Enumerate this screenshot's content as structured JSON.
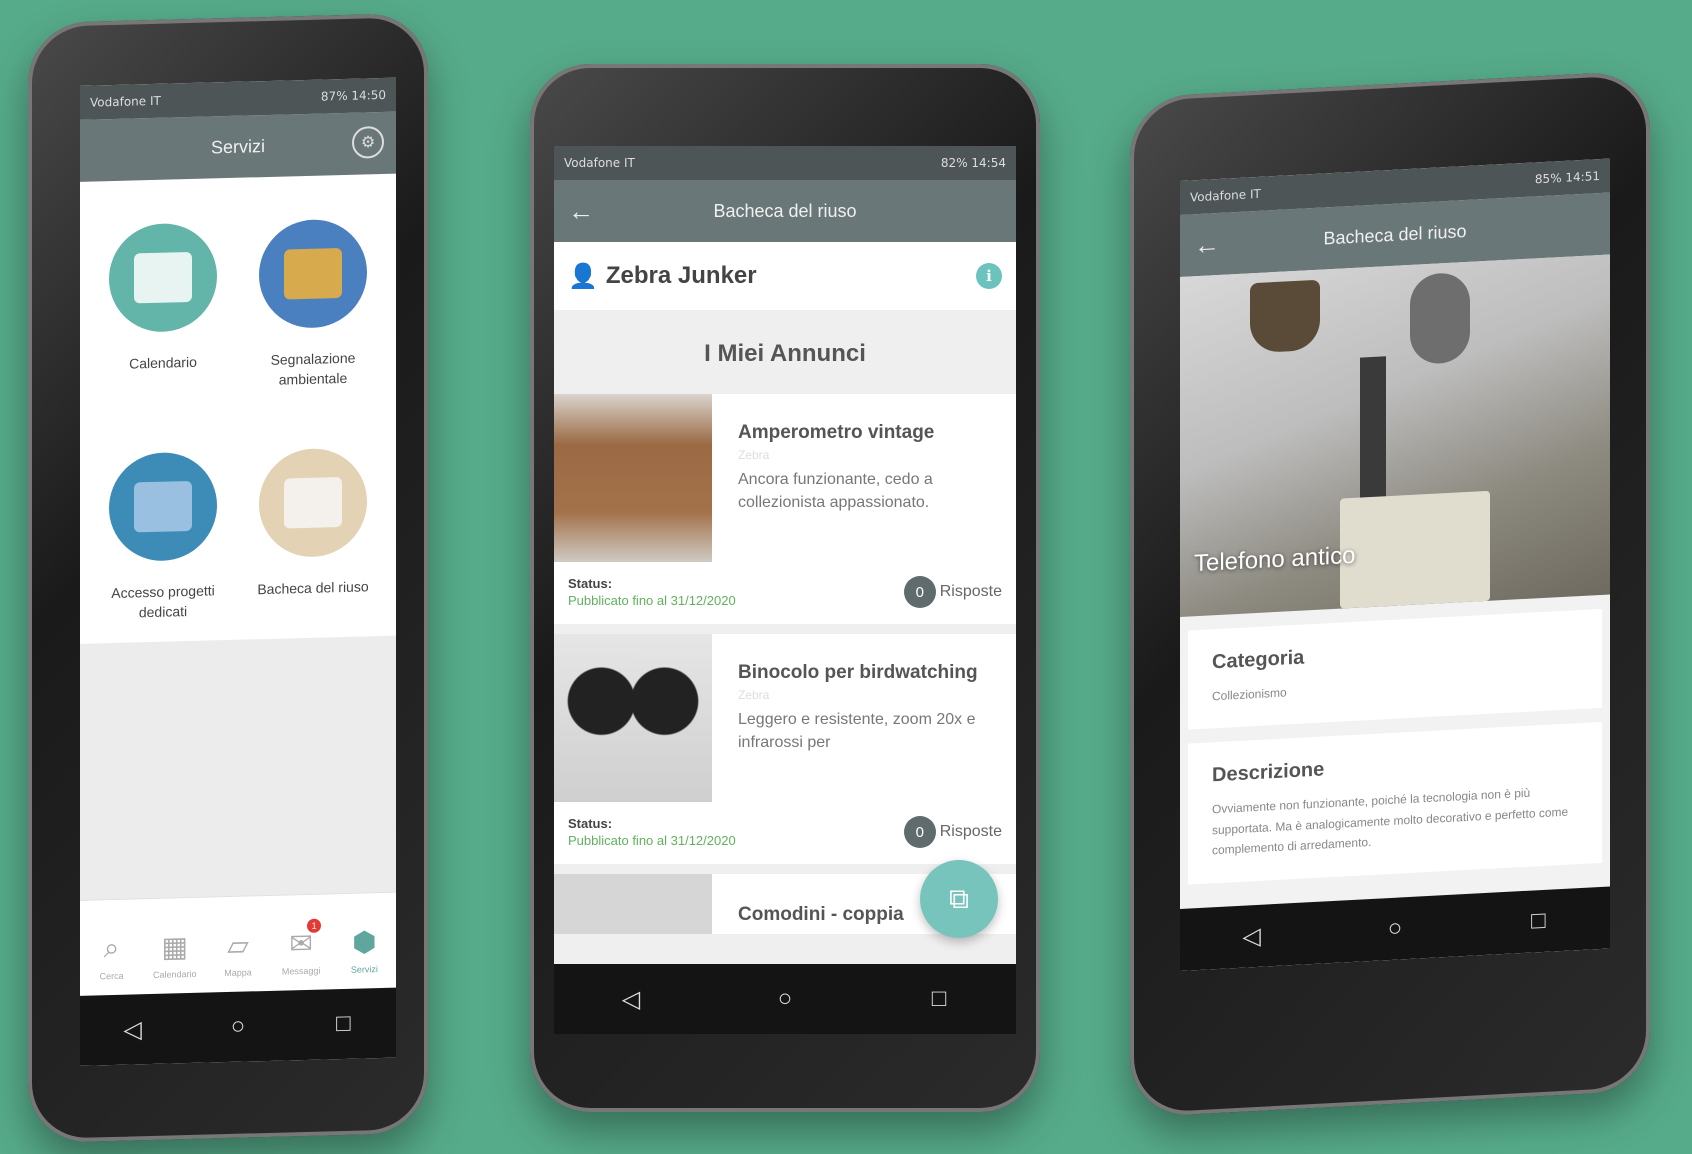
{
  "background_color": "#56ab8a",
  "phone1": {
    "status": {
      "left": "Vodafone IT",
      "right": "87% 14:50"
    },
    "appbar": {
      "title": "Servizi"
    },
    "services": [
      {
        "label": "Calendario",
        "color": "#62b5a8",
        "icon": "calendar-icon"
      },
      {
        "label": "Segnalazione ambientale",
        "color": "#4a7fc0",
        "icon": "report-icon"
      },
      {
        "label": "Accesso progetti dedicati",
        "color": "#3d8cb8",
        "icon": "id-card-icon"
      },
      {
        "label": "Bacheca del riuso",
        "color": "#e3d2b4",
        "icon": "recycle-icon"
      }
    ],
    "tabs": [
      {
        "label": "Cerca",
        "icon": "search-icon"
      },
      {
        "label": "Calendario",
        "icon": "calendar-icon"
      },
      {
        "label": "Mappa",
        "icon": "map-icon"
      },
      {
        "label": "Messaggi",
        "icon": "mail-icon",
        "badge": "1"
      },
      {
        "label": "Servizi",
        "icon": "services-icon"
      }
    ]
  },
  "phone2": {
    "status": {
      "left": "Vodafone IT",
      "right": "82% 14:54"
    },
    "appbar": {
      "title": "Bacheca del riuso"
    },
    "user": {
      "name": "Zebra Junker"
    },
    "section_title": "I Miei Annunci",
    "ads": [
      {
        "title": "Amperometro vintage",
        "owner": "Zebra",
        "desc": "Ancora funzionante, cedo a collezionista appassionato.",
        "status_label": "Status:",
        "status_value": "Pubblicato fino al 31/12/2020",
        "replies_count": "0",
        "replies_label": "Risposte"
      },
      {
        "title": "Binocolo per birdwatching",
        "owner": "Zebra",
        "desc": "Leggero e resistente, zoom 20x e infrarossi per",
        "status_label": "Status:",
        "status_value": "Pubblicato fino al 31/12/2020",
        "replies_count": "0",
        "replies_label": "Risposte"
      },
      {
        "title": "Comodini - coppia"
      }
    ]
  },
  "phone3": {
    "status": {
      "left": "Vodafone IT",
      "right": "85% 14:51"
    },
    "appbar": {
      "title": "Bacheca del riuso"
    },
    "photo_caption": "Telefono antico",
    "categoria": {
      "title": "Categoria",
      "value": "Collezionismo"
    },
    "descrizione": {
      "title": "Descrizione",
      "value": "Ovviamente non funzionante, poiché la tecnologia non è più supportata. Ma è analogicamente molto decorativo e perfetto come complemento di arredamento."
    }
  }
}
